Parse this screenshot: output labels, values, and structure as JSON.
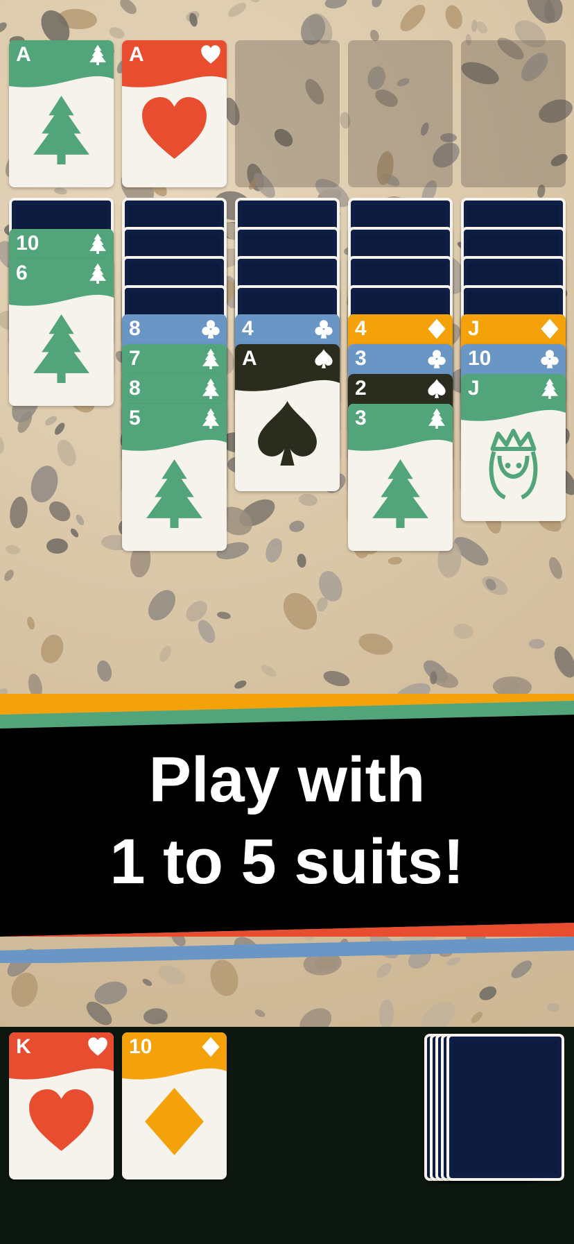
{
  "colors": {
    "green": "#52a57a",
    "red": "#e84d30",
    "orange": "#f5a10a",
    "blue": "#6a96c6",
    "black": "#2a2d1e",
    "card_face": "#f6f3ec",
    "card_back": "#0f1e44",
    "bottom_bar": "#0c170f"
  },
  "banner": {
    "line1": "Play with",
    "line2": "1 to 5 suits!"
  },
  "foundations": [
    {
      "rank": "A",
      "suit": "tree-icon"
    },
    {
      "rank": "A",
      "suit": "heart-icon"
    }
  ],
  "tableau": [
    {
      "face_down": 1,
      "cards": [
        {
          "rank": "10",
          "suit": "tree"
        },
        {
          "rank": "6",
          "suit": "tree"
        }
      ]
    },
    {
      "face_down": 4,
      "cards": [
        {
          "rank": "8",
          "suit": "club"
        },
        {
          "rank": "7",
          "suit": "tree"
        },
        {
          "rank": "8",
          "suit": "tree"
        },
        {
          "rank": "5",
          "suit": "tree"
        }
      ]
    },
    {
      "face_down": 4,
      "cards": [
        {
          "rank": "4",
          "suit": "club"
        },
        {
          "rank": "A",
          "suit": "spade"
        }
      ]
    },
    {
      "face_down": 4,
      "cards": [
        {
          "rank": "4",
          "suit": "diamond"
        },
        {
          "rank": "3",
          "suit": "club"
        },
        {
          "rank": "2",
          "suit": "spade"
        },
        {
          "rank": "3",
          "suit": "tree"
        }
      ]
    },
    {
      "face_down": 4,
      "cards": [
        {
          "rank": "J",
          "suit": "diamond"
        },
        {
          "rank": "10",
          "suit": "club"
        },
        {
          "rank": "J",
          "suit": "tree"
        }
      ]
    }
  ],
  "waste": [
    {
      "rank": "K",
      "suit": "heart"
    },
    {
      "rank": "10",
      "suit": "diamond"
    }
  ]
}
